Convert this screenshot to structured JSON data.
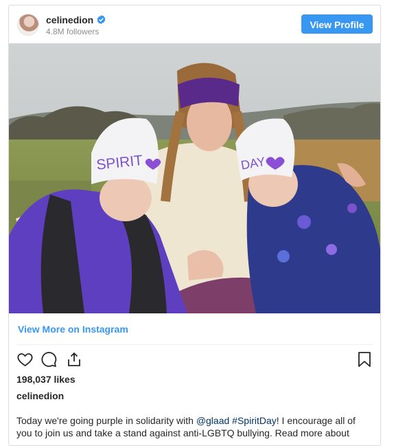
{
  "post": {
    "username": "celinedion",
    "followers": "4.8M followers",
    "view_profile_label": "View Profile",
    "view_more_label": "View More on Instagram",
    "likes": "198,037 likes",
    "caption_user": "celinedion",
    "caption": {
      "part1": "Today we're going purple in solidarity with ",
      "mention": "@glaad",
      "space": " ",
      "hashtag": "#SpiritDay",
      "part2": "! I encourage all of you to join us and take a stand against anti-LGBTQ bullying. Read more about"
    },
    "photo_text": {
      "hat_left": "SPIRIT",
      "hat_right": "DAY"
    }
  },
  "colors": {
    "accent": "#3897f0",
    "verified": "#3897f0",
    "hat_text": "#7b52c8",
    "headband": "#5a2a8a"
  },
  "icons": [
    "verified-icon",
    "heart-icon",
    "comment-icon",
    "share-icon",
    "bookmark-icon"
  ]
}
